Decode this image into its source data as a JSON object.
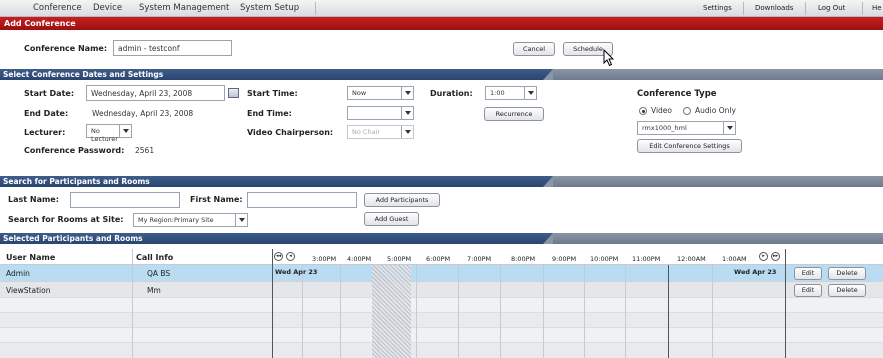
{
  "menu": {
    "items": [
      "Conference",
      "Device",
      "System Management",
      "System Setup"
    ],
    "right": [
      "Settings",
      "Downloads",
      "Log Out",
      "He"
    ]
  },
  "add_conference": {
    "title": "Add Conference",
    "name_label": "Conference Name:",
    "name_value": "admin - testconf",
    "cancel_label": "Cancel",
    "schedule_label": "Schedule"
  },
  "dates": {
    "title": "Select Conference Dates and Settings",
    "start_date_label": "Start Date:",
    "start_date_value": "Wednesday, April 23, 2008",
    "end_date_label": "End Date:",
    "end_date_value": "Wednesday, April 23, 2008",
    "lecturer_label": "Lecturer:",
    "lecturer_value": "No Lecturer",
    "password_label": "Conference Password:",
    "password_value": "2561",
    "start_time_label": "Start Time:",
    "start_time_value": "Now",
    "end_time_label": "End Time:",
    "end_time_value": "",
    "chair_label": "Video Chairperson:",
    "chair_value": "No Chair",
    "duration_label": "Duration:",
    "duration_value": "1:00",
    "recurrence_label": "Recurrence",
    "type_label": "Conference Type",
    "type_video": "Video",
    "type_audio": "Audio Only",
    "profile_value": "rmx1000_hml",
    "edit_settings_label": "Edit Conference Settings"
  },
  "search": {
    "title": "Search for Participants and Rooms",
    "last_name_label": "Last Name:",
    "last_name_value": "",
    "first_name_label": "First Name:",
    "first_name_value": "",
    "add_participants_label": "Add Participants",
    "rooms_label": "Search for Rooms at Site:",
    "site_value": "My Region:Primary Site",
    "add_guest_label": "Add Guest"
  },
  "selected": {
    "title": "Selected Participants and Rooms",
    "col_user": "User Name",
    "col_call": "Call Info",
    "hours": [
      "3:00PM",
      "4:00PM",
      "5:00PM",
      "6:00PM",
      "7:00PM",
      "8:00PM",
      "9:00PM",
      "10:00PM",
      "11:00PM",
      "12:00AM",
      "1:00AM"
    ],
    "day_left": "Wed Apr 23",
    "day_right": "Wed Apr 23",
    "rows": [
      {
        "user": "Admin",
        "call": "QA BS",
        "edit": "Edit",
        "delete": "Delete"
      },
      {
        "user": "ViewStation",
        "call": "Mm",
        "edit": "Edit",
        "delete": "Delete"
      }
    ]
  },
  "colors": {
    "red_header": "#b01818",
    "blue_header": "#34507c",
    "selected_row": "#b9dcf3"
  }
}
